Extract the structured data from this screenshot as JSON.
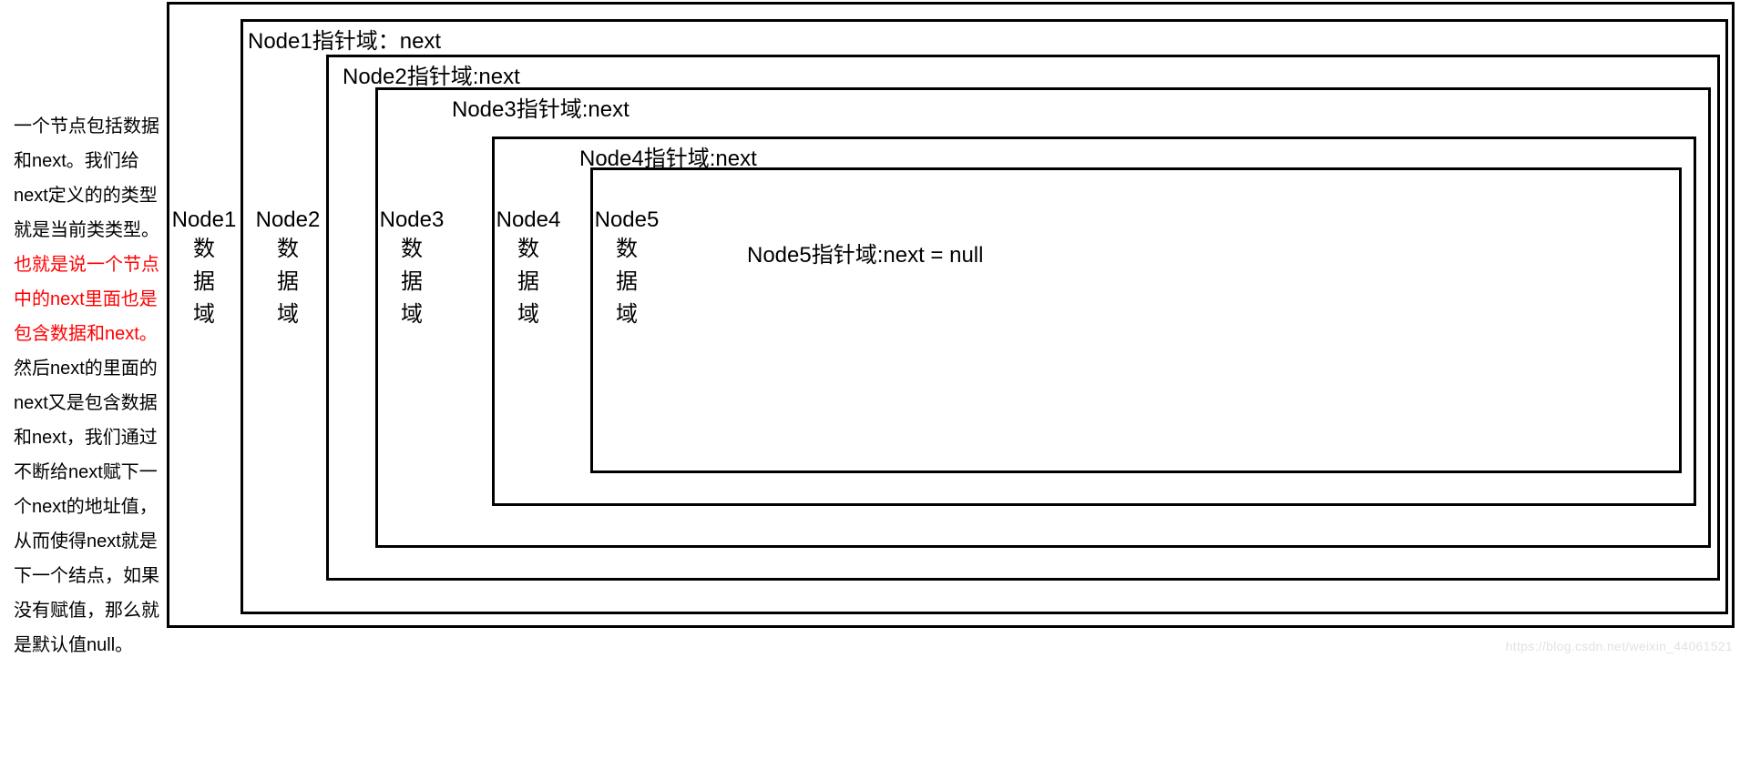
{
  "side": {
    "p1": "一个节点包括数据和next。我们给next定义的的类型就是当前类类型。",
    "hl": "也就是说一个节点中的next里面也是包含数据和next。",
    "p2": "然后next的里面的next又是包含数据和next，我们通过不断给next赋下一个next的地址值，从而使得next就是下一个结点，如果没有赋值，那么就是默认值null。"
  },
  "nodes": {
    "n1": {
      "title": "Node1指针域：next",
      "name": "Node1",
      "field": "数据域"
    },
    "n2": {
      "title": "Node2指针域:next",
      "name": "Node2",
      "field": "数据域"
    },
    "n3": {
      "title": "Node3指针域:next",
      "name": "Node3",
      "field": "数据域"
    },
    "n4": {
      "title": "Node4指针域:next",
      "name": "Node4",
      "field": "数据域"
    },
    "n5": {
      "title": "Node5指针域:next = null",
      "name": "Node5",
      "field": "数据域"
    }
  },
  "watermark": "https://blog.csdn.net/weixin_44061521"
}
